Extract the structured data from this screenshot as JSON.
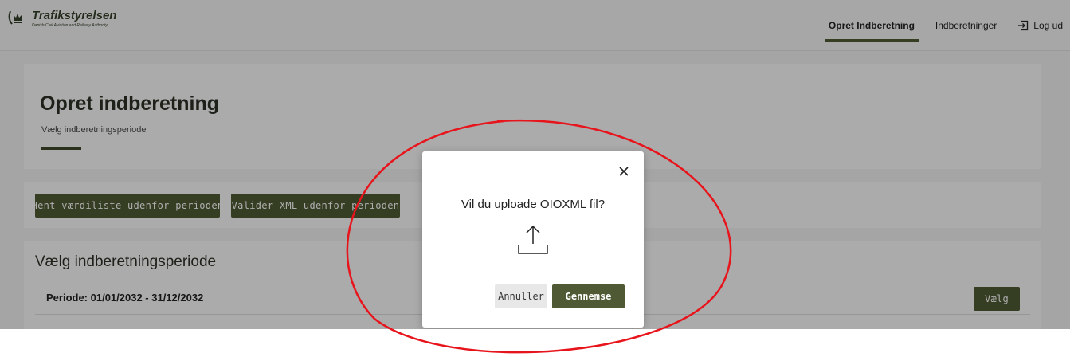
{
  "brand": {
    "name": "Trafikstyrelsen",
    "tagline": "Danish Civil Aviation and Railway Authority",
    "logo_icon": "crown-icon",
    "color": "#34402a"
  },
  "nav": {
    "items": [
      {
        "label": "Opret Indberetning",
        "active": true
      },
      {
        "label": "Indberetninger",
        "active": false
      }
    ],
    "logout_label": "Log ud",
    "logout_icon": "logout-icon"
  },
  "page": {
    "title": "Opret indberetning",
    "subtitle": "Vælg indberetningsperiode"
  },
  "actions": {
    "fetch_values_label": "Hent værdiliste udenfor perioden",
    "validate_xml_label": "Valider XML udenfor perioden"
  },
  "period_section": {
    "title": "Vælg indberetningsperiode",
    "periods": [
      {
        "label": "Periode: 01/01/2032 - 31/12/2032",
        "select_label": "Vælg"
      }
    ]
  },
  "modal": {
    "question": "Vil du uploade OIOXML fil?",
    "icon": "upload-icon",
    "cancel_label": "Annuller",
    "browse_label": "Gennemse"
  },
  "colors": {
    "accent": "#4f5a34",
    "annotation": "#e8141c"
  }
}
